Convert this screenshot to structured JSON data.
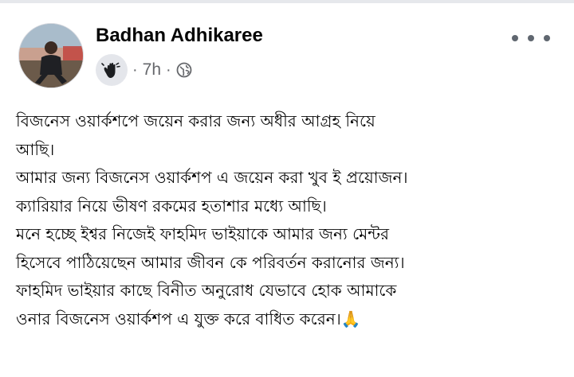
{
  "post": {
    "author_name": "Badhan Adhikaree",
    "time": "7h",
    "separator": "·",
    "privacy_icon": "globe-icon",
    "badge_icon": "hand-wave-icon",
    "more_icon": "more-horizontal-icon",
    "body_lines": [
      "বিজনেস ওয়ার্কশপে জয়েন করার জন্য অধীর আগ্রহ নিয়ে",
      "আছি।",
      "আমার জন্য বিজনেস ওয়ার্কশপ এ জয়েন করা খুব ই প্রয়োজন।",
      "ক্যারিয়ার নিয়ে ভীষণ রকমের হতাশার মধ্যে আছি।",
      "মনে হচ্ছে ইশ্বর নিজেই ফাহমিদ ভাইয়াকে আমার জন্য মেন্টর",
      "হিসেবে পাঠিয়েছেন আমার জীবন কে পরিবর্তন করানোর জন্য।",
      "ফাহমিদ ভাইয়ার কাছে বিনীত অনুরোধ যেভাবে হোক আমাকে",
      "ওনার বিজনেস ওয়ার্কশপ এ যুক্ত করে বাধিত করেন।"
    ],
    "end_emoji": "🙏"
  },
  "colors": {
    "text": "#050505",
    "secondary_text": "#65676b",
    "badge_bg": "#e4e6eb"
  }
}
